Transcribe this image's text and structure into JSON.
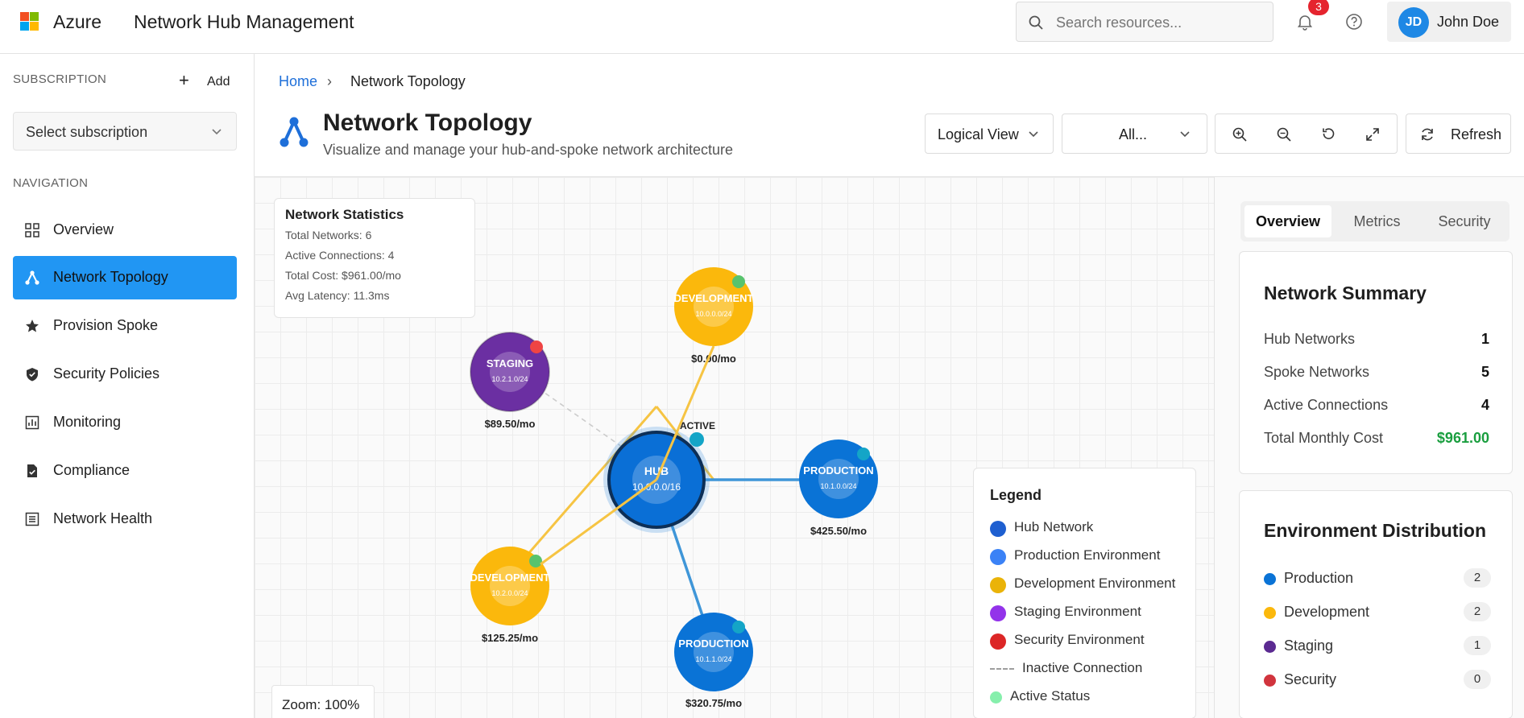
{
  "header": {
    "brand": "Azure",
    "app_title": "Network Hub Management",
    "search_placeholder": "Search resources...",
    "notification_count": "3",
    "user_initials": "JD",
    "user_name": "John Doe"
  },
  "sidebar": {
    "subscription_label": "SUBSCRIPTION",
    "add_label": "Add",
    "subscription_select": "Select subscription",
    "navigation_label": "NAVIGATION",
    "items": [
      {
        "label": "Overview",
        "icon": "grid-icon",
        "active": false
      },
      {
        "label": "Network Topology",
        "icon": "topology-icon",
        "active": true
      },
      {
        "label": "Provision Spoke",
        "icon": "star-icon",
        "active": false
      },
      {
        "label": "Security Policies",
        "icon": "shield-icon",
        "active": false
      },
      {
        "label": "Monitoring",
        "icon": "chart-icon",
        "active": false
      },
      {
        "label": "Compliance",
        "icon": "checklist-icon",
        "active": false
      },
      {
        "label": "Network Health",
        "icon": "list-icon",
        "active": false
      }
    ]
  },
  "main": {
    "breadcrumb": {
      "home": "Home",
      "separator": "›",
      "current": "Network Topology"
    },
    "title": "Network Topology",
    "subtitle": "Visualize and manage your hub-and-spoke network architecture",
    "view_select": "Logical View",
    "filter_select": "All...",
    "refresh_label": "Refresh"
  },
  "canvas": {
    "stats": {
      "title": "Network Statistics",
      "lines": [
        "Total Networks: 6",
        "Active Connections: 4",
        "Total Cost: $961.00/mo",
        "Avg Latency: 11.3ms"
      ]
    },
    "zoom": "Zoom: 100%",
    "active_label": "ACTIVE",
    "nodes": [
      {
        "name": "HUB",
        "cidr": "10.0.0.0/16",
        "cost": "",
        "type": "hub"
      },
      {
        "name": "DEVELOPMENT",
        "cidr": "10.0.0.0/24",
        "cost": "$0.00/mo",
        "type": "dev"
      },
      {
        "name": "STAGING",
        "cidr": "10.2.1.0/24",
        "cost": "$89.50/mo",
        "type": "staging"
      },
      {
        "name": "PRODUCTION",
        "cidr": "10.1.0.0/24",
        "cost": "$425.50/mo",
        "type": "prod"
      },
      {
        "name": "DEVELOPMENT",
        "cidr": "10.2.0.0/24",
        "cost": "$125.25/mo",
        "type": "dev"
      },
      {
        "name": "PRODUCTION",
        "cidr": "10.1.1.0/24",
        "cost": "$320.75/mo",
        "type": "prod"
      }
    ],
    "legend": {
      "title": "Legend",
      "items": [
        {
          "label": "Hub Network",
          "color": "#1e5fd0"
        },
        {
          "label": "Production Environment",
          "color": "#3b82f6"
        },
        {
          "label": "Development Environment",
          "color": "#eab308"
        },
        {
          "label": "Staging Environment",
          "color": "#9333ea"
        },
        {
          "label": "Security Environment",
          "color": "#dc2626"
        },
        {
          "label": "Inactive Connection",
          "color": "#9e9e9e"
        },
        {
          "label": "Active Status",
          "color": "#86efac"
        }
      ]
    },
    "colors": {
      "hub": "#0a6fd6",
      "prod": "#0a73d6",
      "dev": "#fbb80c",
      "staging": "#6b2fa2",
      "dev_line": "#f6c443",
      "prod_line": "#3f96d8"
    }
  },
  "right_panel": {
    "tabs": [
      "Overview",
      "Metrics",
      "Security"
    ],
    "summary": {
      "title": "Network Summary",
      "rows": [
        {
          "label": "Hub Networks",
          "value": "1"
        },
        {
          "label": "Spoke Networks",
          "value": "5"
        },
        {
          "label": "Active Connections",
          "value": "4"
        },
        {
          "label": "Total Monthly Cost",
          "value": "$961.00"
        }
      ]
    },
    "distribution": {
      "title": "Environment Distribution",
      "rows": [
        {
          "label": "Production",
          "count": "2",
          "color": "#0a73d6"
        },
        {
          "label": "Development",
          "count": "2",
          "color": "#fbb80c"
        },
        {
          "label": "Staging",
          "count": "1",
          "color": "#5b2a91"
        },
        {
          "label": "Security",
          "count": "0",
          "color": "#d1343d"
        }
      ]
    }
  }
}
